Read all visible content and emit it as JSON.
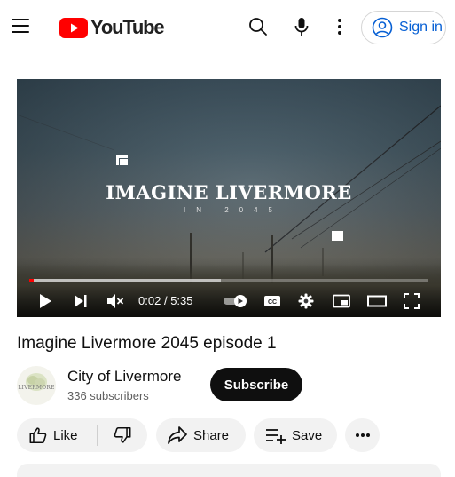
{
  "header": {
    "logo_text": "YouTube",
    "signin_label": "Sign in",
    "icons": [
      "menu-icon",
      "search-icon",
      "microphone-icon",
      "more-vertical-icon",
      "account-icon"
    ],
    "brand_color": "#ff0000",
    "link_color": "#065fd4"
  },
  "player": {
    "overlay_title": "IMAGINE LIVERMORE",
    "overlay_subtitle": "IN 2045",
    "current_time": "0:02",
    "time_separator": "/",
    "duration": "5:35",
    "played_fraction": 0.006,
    "buffered_fraction": 0.48,
    "autoplay_on": true,
    "icons": [
      "play-icon",
      "next-icon",
      "mute-icon",
      "autoplay-toggle",
      "captions-icon",
      "settings-icon",
      "miniplayer-icon",
      "theater-icon",
      "fullscreen-icon"
    ]
  },
  "video": {
    "title": "Imagine Livermore 2045 episode 1"
  },
  "channel": {
    "avatar_text": "LIVERMORE",
    "name": "City of Livermore",
    "subscribers": "336 subscribers",
    "subscribe_label": "Subscribe"
  },
  "actions": {
    "like_label": "Like",
    "share_label": "Share",
    "save_label": "Save",
    "icons": [
      "thumbs-up-icon",
      "thumbs-down-icon",
      "share-icon",
      "save-playlist-icon",
      "more-horizontal-icon"
    ]
  }
}
